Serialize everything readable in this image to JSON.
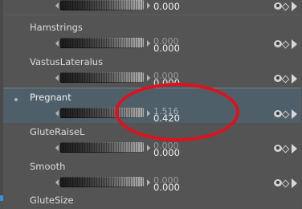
{
  "colors": {
    "background": "#545454",
    "active_row": "#4f5f69",
    "annotation": "#e0111d",
    "text": "#dcdcdc"
  },
  "rows": [
    {
      "label": "",
      "value_top": "",
      "value": "0.000"
    },
    {
      "label": "Hamstrings",
      "value_top": "0.000",
      "value": "0.000"
    },
    {
      "label": "VastusLateralus",
      "value_top": "0.000",
      "value": "0.000"
    },
    {
      "label": "Pregnant",
      "value_top": "1.516",
      "value": "0.420",
      "active": true
    },
    {
      "label": "GluteRaiseL",
      "value_top": "0.000",
      "value": "0.000"
    },
    {
      "label": "Smooth",
      "value_top": "0.000",
      "value": "0.000"
    },
    {
      "label": "GluteSize",
      "value_top": "",
      "value": ""
    }
  ],
  "icons": {
    "visibility": "eye-icon",
    "key": "diamond-key-icon",
    "expand": "play-arrow-icon",
    "decrease": "arrow-left-icon",
    "increase": "arrow-right-icon"
  }
}
